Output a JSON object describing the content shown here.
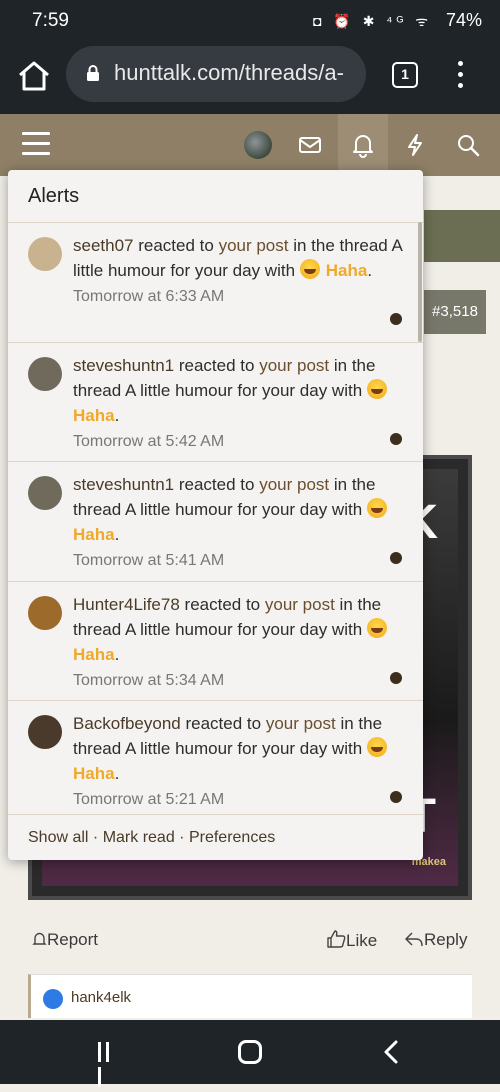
{
  "status_bar": {
    "time": "7:59",
    "icons": "◘ ⏰ ✱ ⁴ᴳ ᯤ",
    "battery": "74%"
  },
  "browser": {
    "url": "hunttalk.com/threads/a-",
    "tab_count": "1"
  },
  "alerts": {
    "title": "Alerts",
    "items": [
      {
        "user": "seeth07",
        "text1": " reacted to ",
        "link": "your post",
        "text2": " in the thread A little humour for your day with ",
        "reaction": "Haha",
        "suffix": ".",
        "time": "Tomorrow at 6:33 AM",
        "avatar_color": "#c9b38e"
      },
      {
        "user": "steveshuntn1",
        "text1": " reacted to ",
        "link": "your post",
        "text2": " in the thread A little humour for your day with ",
        "reaction": "Haha",
        "suffix": ".",
        "time": "Tomorrow at 5:42 AM",
        "avatar_color": "#6f6a5c"
      },
      {
        "user": "steveshuntn1",
        "text1": " reacted to ",
        "link": "your post",
        "text2": " in the thread A little humour for your day with ",
        "reaction": "Haha",
        "suffix": ".",
        "time": "Tomorrow at 5:41 AM",
        "avatar_color": "#6f6a5c"
      },
      {
        "user": "Hunter4Life78",
        "text1": " reacted to ",
        "link": "your post",
        "text2": " in the thread A little humour for your day with ",
        "reaction": "Haha",
        "suffix": ".",
        "time": "Tomorrow at 5:34 AM",
        "avatar_color": "#9c6a2a"
      },
      {
        "user": "Backofbeyond",
        "text1": " reacted to ",
        "link": "your post",
        "text2": " in the thread A little humour for your day with ",
        "reaction": "Haha",
        "suffix": ".",
        "time": "Tomorrow at 5:21 AM",
        "avatar_color": "#4a3a2c"
      }
    ],
    "footer": {
      "show_all": "Show all",
      "sep1": " · ",
      "mark_read": "Mark read",
      "sep2": " · ",
      "preferences": "Preferences"
    }
  },
  "background": {
    "post_number": "#3,518",
    "card_letter_top": "K",
    "card_letter_bottom": "T",
    "card_watermark": "makea",
    "report_label": "Report",
    "like_label": "Like",
    "reply_label": "Reply",
    "reaction_user": "hank4elk"
  }
}
